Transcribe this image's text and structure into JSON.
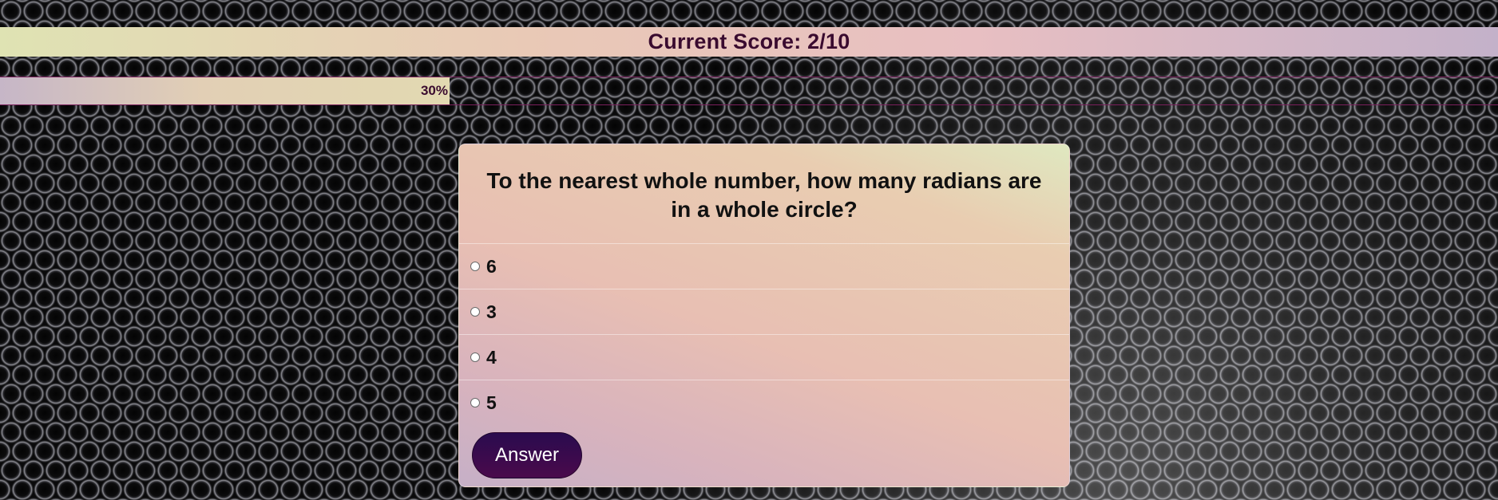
{
  "score": {
    "text": "Current Score: 2/10"
  },
  "progress": {
    "label": "30%",
    "value": 0.3
  },
  "quiz": {
    "question": "To the nearest whole number, how many radians are in a whole circle?",
    "options": [
      {
        "label": "6"
      },
      {
        "label": "3"
      },
      {
        "label": "4"
      },
      {
        "label": "5"
      }
    ],
    "submit_label": "Answer"
  },
  "colors": {
    "score_text": "#3a0b2f",
    "button_bg": "#3a0b4e",
    "progress_border": "#7a1f5c"
  }
}
